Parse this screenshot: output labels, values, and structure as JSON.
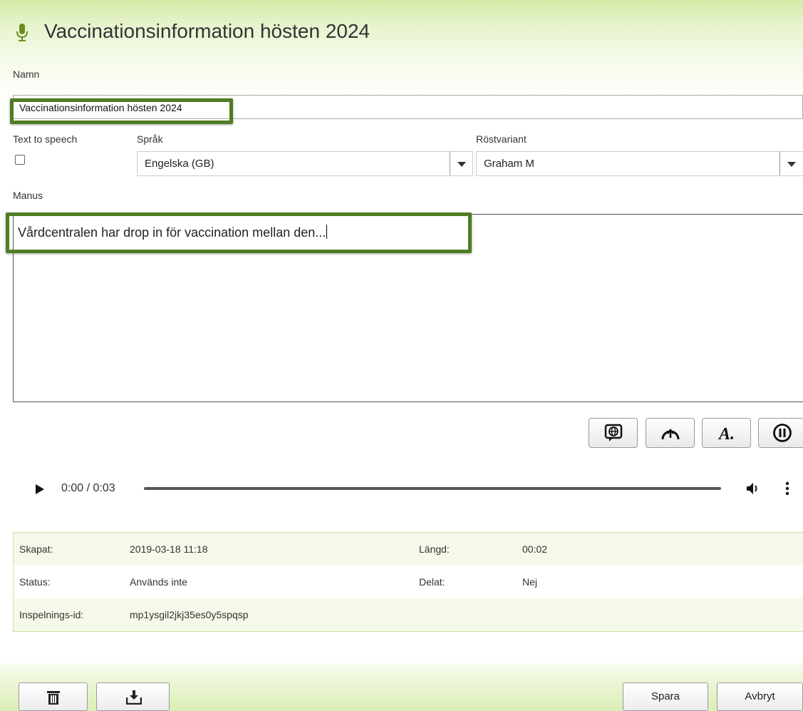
{
  "header": {
    "title": "Vaccinationsinformation hösten 2024",
    "icon": "microphone-icon"
  },
  "form": {
    "name_label": "Namn",
    "name_value": "Vaccinationsinformation hösten 2024",
    "tts_label": "Text to speech",
    "tts_checked": false,
    "language_label": "Språk",
    "language_value": "Engelska (GB)",
    "voice_label": "Röstvariant",
    "voice_value": "Graham  M",
    "script_label": "Manus",
    "script_value": "Vårdcentralen har drop in för vaccination mellan den..."
  },
  "tools": [
    {
      "name": "language-tool-button",
      "icon": "globe-speech-icon"
    },
    {
      "name": "speed-tool-button",
      "icon": "speedometer-icon"
    },
    {
      "name": "emphasis-tool-button",
      "icon": "letter-a-icon"
    },
    {
      "name": "pause-tool-button",
      "icon": "pause-icon"
    }
  ],
  "player": {
    "time": "0:00 / 0:03",
    "progress": 0
  },
  "info": {
    "created_label": "Skapat:",
    "created_value": "2019-03-18 11:18",
    "length_label": "Längd:",
    "length_value": "00:02",
    "status_label": "Status:",
    "status_value": "Används inte",
    "shared_label": "Delat:",
    "shared_value": "Nej",
    "recording_id_label": "Inspelnings-id:",
    "recording_id_value": "mp1ysgil2jkj35es0y5spqsp"
  },
  "footer": {
    "save_label": "Spara",
    "cancel_label": "Avbryt"
  },
  "colors": {
    "accent_green": "#4f7d22",
    "header_green": "#d4eaa6",
    "row_stripe": "#f4f9e9"
  }
}
